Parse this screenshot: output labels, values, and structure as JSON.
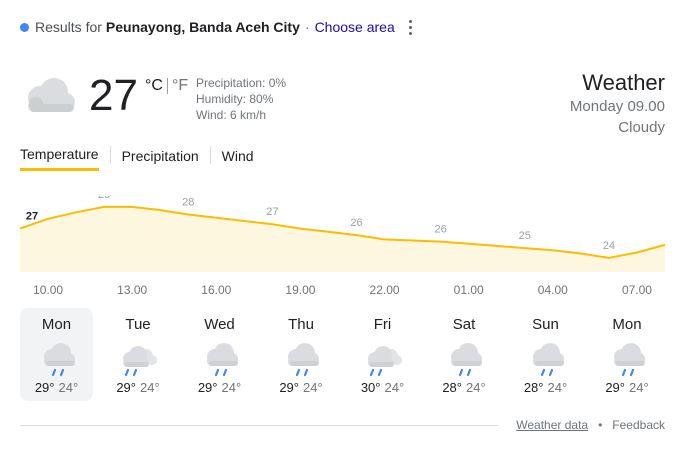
{
  "header": {
    "prefix": "Results for",
    "location": "Peunayong, Banda Aceh City",
    "separator": "·",
    "choose_area": "Choose area"
  },
  "current": {
    "icon": "cloud-icon",
    "temperature": "27",
    "unit_c": "°C",
    "unit_f": "°F",
    "precipitation": "Precipitation: 0%",
    "humidity": "Humidity: 80%",
    "wind": "Wind: 6 km/h",
    "title": "Weather",
    "datetime": "Monday 09.00",
    "condition": "Cloudy"
  },
  "tabs": [
    {
      "label": "Temperature",
      "active": true
    },
    {
      "label": "Precipitation",
      "active": false
    },
    {
      "label": "Wind",
      "active": false
    }
  ],
  "chart_data": {
    "type": "area",
    "x": [
      "09.00",
      "10.00",
      "11.00",
      "12.00",
      "13.00",
      "14.00",
      "15.00",
      "16.00",
      "17.00",
      "18.00",
      "19.00",
      "20.00",
      "21.00",
      "22.00",
      "23.00",
      "00.00",
      "01.00",
      "02.00",
      "03.00",
      "04.00",
      "05.00",
      "06.00",
      "07.00",
      "08.00"
    ],
    "values": [
      27,
      27.9,
      28.5,
      29,
      29,
      28.7,
      28.3,
      28,
      27.7,
      27.4,
      27,
      26.7,
      26.4,
      26,
      25.9,
      25.8,
      25.6,
      25.4,
      25.2,
      25,
      24.7,
      24.3,
      24.8,
      25.5
    ],
    "labels": [
      {
        "index": 0,
        "text": "27"
      },
      {
        "index": 3,
        "text": "29"
      },
      {
        "index": 6,
        "text": "28"
      },
      {
        "index": 9,
        "text": "27"
      },
      {
        "index": 12,
        "text": "26"
      },
      {
        "index": 15,
        "text": "26"
      },
      {
        "index": 18,
        "text": "25"
      },
      {
        "index": 21,
        "text": "24"
      }
    ],
    "x_ticks": [
      "10.00",
      "13.00",
      "16.00",
      "19.00",
      "22.00",
      "01.00",
      "04.00",
      "07.00"
    ],
    "ylim": [
      23,
      30
    ],
    "line_color": "#fbbc04",
    "fill_color": "#fef7e0"
  },
  "forecast": [
    {
      "day": "Mon",
      "icon": "rain-cloud-icon",
      "high": "29°",
      "low": "24°",
      "selected": true
    },
    {
      "day": "Tue",
      "icon": "rain-partly-cloudy-icon",
      "high": "29°",
      "low": "24°",
      "selected": false
    },
    {
      "day": "Wed",
      "icon": "rain-cloud-icon",
      "high": "29°",
      "low": "24°",
      "selected": false
    },
    {
      "day": "Thu",
      "icon": "rain-cloud-icon",
      "high": "29°",
      "low": "24°",
      "selected": false
    },
    {
      "day": "Fri",
      "icon": "rain-partly-cloudy-icon",
      "high": "30°",
      "low": "24°",
      "selected": false
    },
    {
      "day": "Sat",
      "icon": "rain-cloud-icon",
      "high": "28°",
      "low": "24°",
      "selected": false
    },
    {
      "day": "Sun",
      "icon": "rain-cloud-icon",
      "high": "28°",
      "low": "24°",
      "selected": false
    },
    {
      "day": "Mon",
      "icon": "rain-cloud-icon",
      "high": "29°",
      "low": "24°",
      "selected": false
    }
  ],
  "footer": {
    "weather_data": "Weather data",
    "dot": "•",
    "feedback": "Feedback"
  }
}
